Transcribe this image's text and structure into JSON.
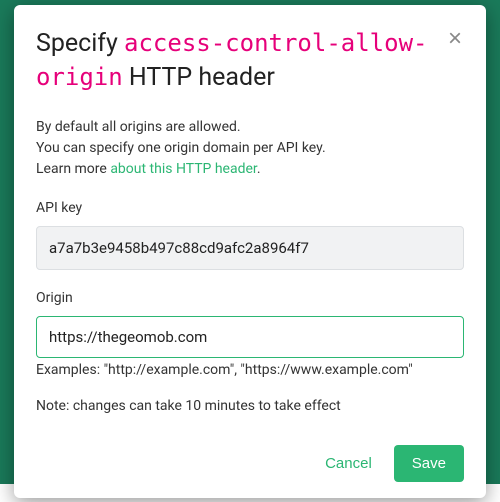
{
  "modal": {
    "title_prefix": "Specify",
    "title_code": "access-control-allow-origin",
    "title_suffix": "HTTP header",
    "close_label": "×",
    "description_line1": "By default all origins are allowed.",
    "description_line2": "You can specify one origin domain per API key.",
    "learn_more_prefix": "Learn more ",
    "learn_more_link": "about this HTTP header",
    "learn_more_suffix": ".",
    "api_key_label": "API key",
    "api_key_value": "a7a7b3e9458b497c88cd9afc2a8964f7",
    "origin_label": "Origin",
    "origin_value": "https://thegeomob.com",
    "examples_text": "Examples: \"http://example.com\", \"https://www.example.com\"",
    "note_text": "Note: changes can take 10 minutes to take effect",
    "cancel_label": "Cancel",
    "save_label": "Save"
  },
  "colors": {
    "accent": "#2bb673",
    "code_pink": "#e6007a"
  }
}
